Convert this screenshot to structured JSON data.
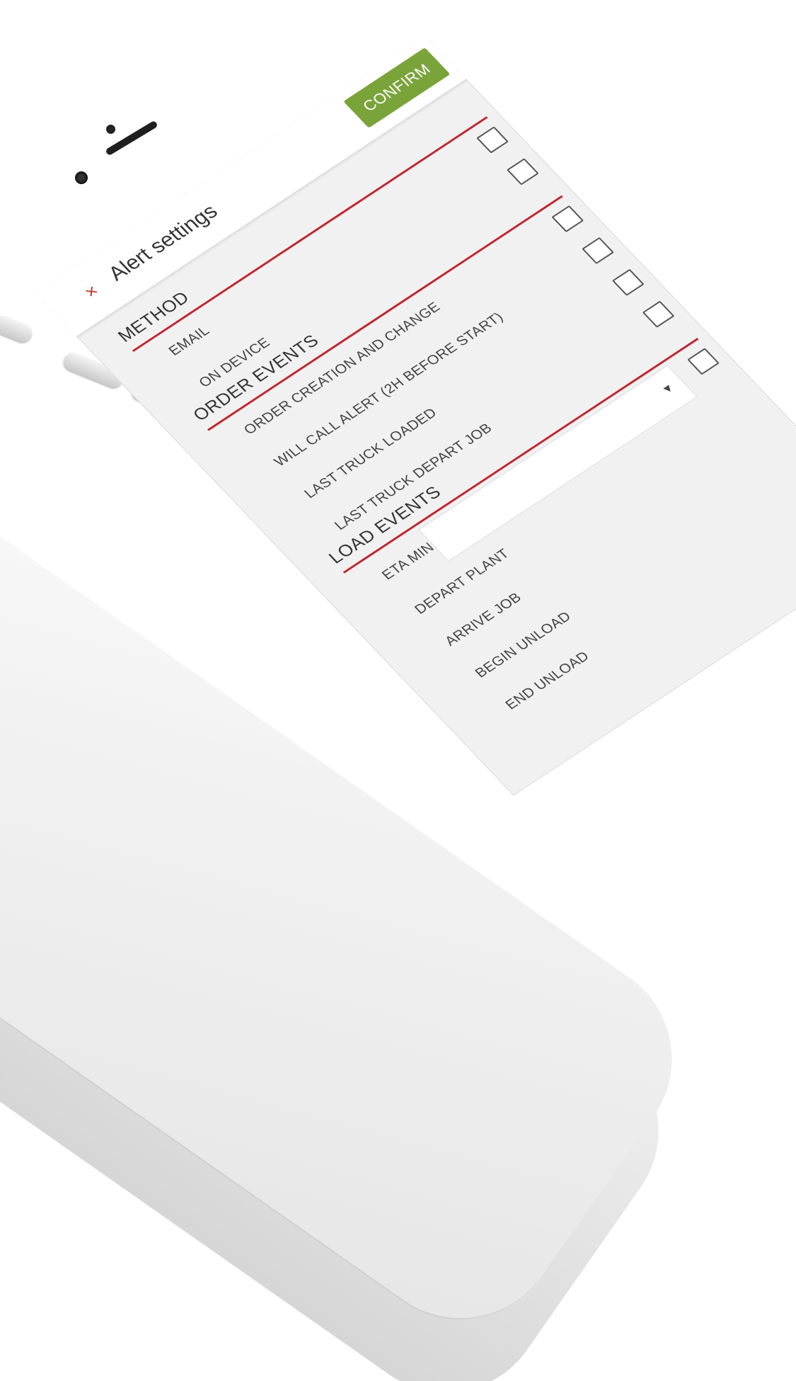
{
  "header": {
    "close_icon": "×",
    "title": "Alert settings",
    "confirm_label": "CONFIRM"
  },
  "sections": {
    "method": {
      "title": "METHOD",
      "items": [
        "EMAIL",
        "ON DEVICE"
      ]
    },
    "order_events": {
      "title": "ORDER EVENTS",
      "items": [
        "ORDER CREATION AND CHANGE",
        "WILL CALL ALERT (2H BEFORE START)",
        "LAST TRUCK LOADED",
        "LAST TRUCK DEPART JOB"
      ]
    },
    "load_events": {
      "title": "LOAD EVENTS",
      "eta_label": "ETA MIN",
      "select_arrow": "▼",
      "items": [
        "DEPART PLANT",
        "ARRIVE JOB",
        "BEGIN UNLOAD",
        "END UNLOAD"
      ]
    }
  },
  "colors": {
    "accent_red": "#c0262f",
    "confirm_green": "#7aa43a"
  }
}
